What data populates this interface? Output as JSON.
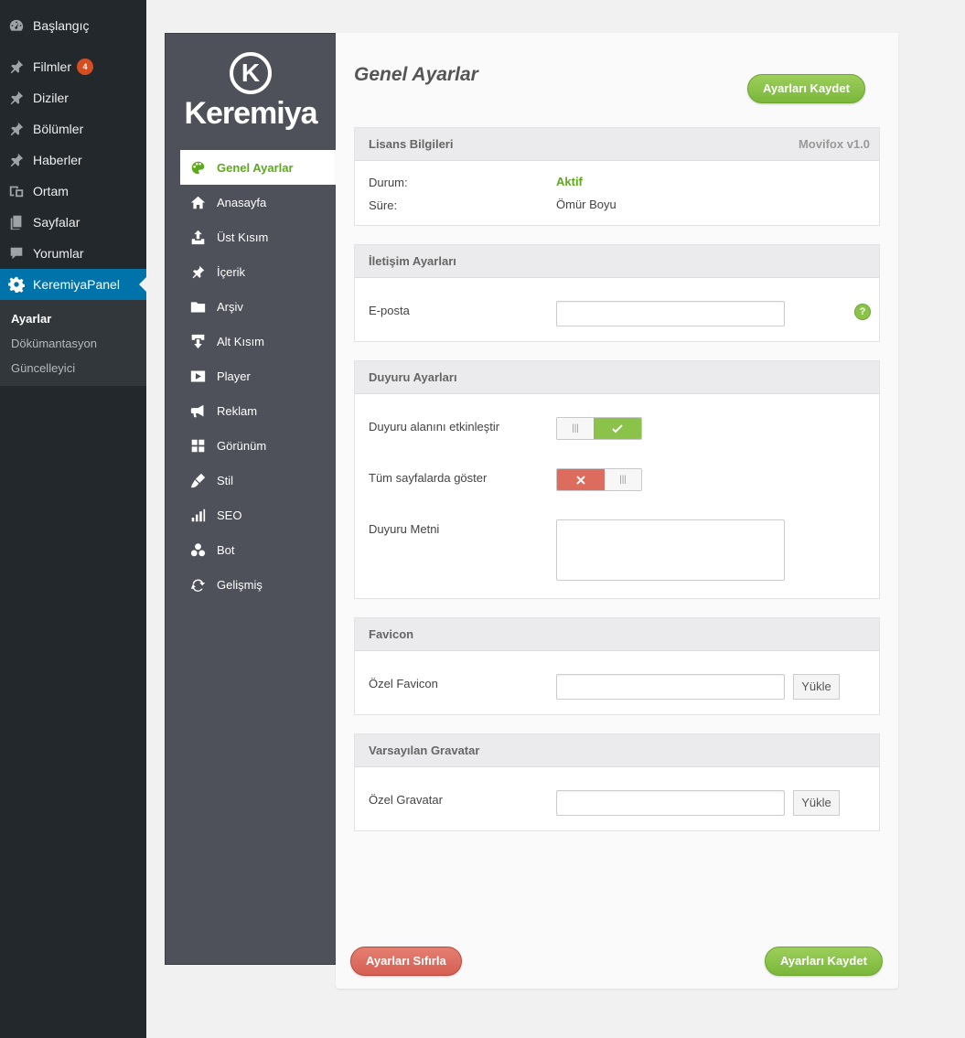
{
  "wp_menu": {
    "items": [
      {
        "label": "Başlangıç",
        "icon": "dashboard-icon"
      },
      {
        "label": "Filmler",
        "icon": "pin-icon",
        "badge": "4"
      },
      {
        "label": "Diziler",
        "icon": "pin-icon"
      },
      {
        "label": "Bölümler",
        "icon": "pin-icon"
      },
      {
        "label": "Haberler",
        "icon": "pin-icon"
      },
      {
        "label": "Ortam",
        "icon": "media-icon"
      },
      {
        "label": "Sayfalar",
        "icon": "pages-icon"
      },
      {
        "label": "Yorumlar",
        "icon": "comment-icon"
      },
      {
        "label": "KeremiyaPanel",
        "icon": "gear-icon"
      }
    ],
    "submenu": [
      "Ayarlar",
      "Dökümantasyon",
      "Güncelleyici"
    ],
    "colors": {
      "bg": "#23282d",
      "active": "#0073aa",
      "sub_bg": "#32373c"
    }
  },
  "panel": {
    "logo": {
      "letter": "K",
      "brand": "Keremiya"
    },
    "nav": [
      {
        "label": "Genel Ayarlar",
        "icon": "palette-icon"
      },
      {
        "label": "Anasayfa",
        "icon": "home-icon"
      },
      {
        "label": "Üst Kısım",
        "icon": "upload-icon"
      },
      {
        "label": "İçerik",
        "icon": "pin-icon"
      },
      {
        "label": "Arşiv",
        "icon": "folder-icon"
      },
      {
        "label": "Alt Kısım",
        "icon": "download-icon"
      },
      {
        "label": "Player",
        "icon": "play-icon"
      },
      {
        "label": "Reklam",
        "icon": "megaphone-icon"
      },
      {
        "label": "Görünüm",
        "icon": "grid-icon"
      },
      {
        "label": "Stil",
        "icon": "brush-icon"
      },
      {
        "label": "SEO",
        "icon": "bar-chart-icon"
      },
      {
        "label": "Bot",
        "icon": "circles-icon"
      },
      {
        "label": "Gelişmiş",
        "icon": "refresh-icon"
      }
    ],
    "colors": {
      "sidebar": "#4e5159",
      "accent_green": "#8bc34a",
      "danger_red": "#dd6b5e"
    }
  },
  "main": {
    "title": "Genel Ayarlar",
    "save_label": "Ayarları Kaydet",
    "reset_label": "Ayarları Sıfırla",
    "license": {
      "heading": "Lisans Bilgileri",
      "version": "Movifox v1.0",
      "status_label": "Durum:",
      "status_value": "Aktif",
      "duration_label": "Süre:",
      "duration_value": "Ömür Boyu"
    },
    "contact": {
      "heading": "İletişim Ayarları",
      "email_label": "E-posta",
      "email_value": "",
      "help": "?"
    },
    "announcement": {
      "heading": "Duyuru Ayarları",
      "enable_label": "Duyuru alanını etkinleştir",
      "enable_state": true,
      "all_pages_label": "Tüm sayfalarda göster",
      "all_pages_state": false,
      "text_label": "Duyuru Metni",
      "text_value": ""
    },
    "favicon": {
      "heading": "Favicon",
      "field_label": "Özel Favicon",
      "upload_label": "Yükle"
    },
    "gravatar": {
      "heading": "Varsayılan Gravatar",
      "field_label": "Özel Gravatar",
      "upload_label": "Yükle"
    }
  }
}
